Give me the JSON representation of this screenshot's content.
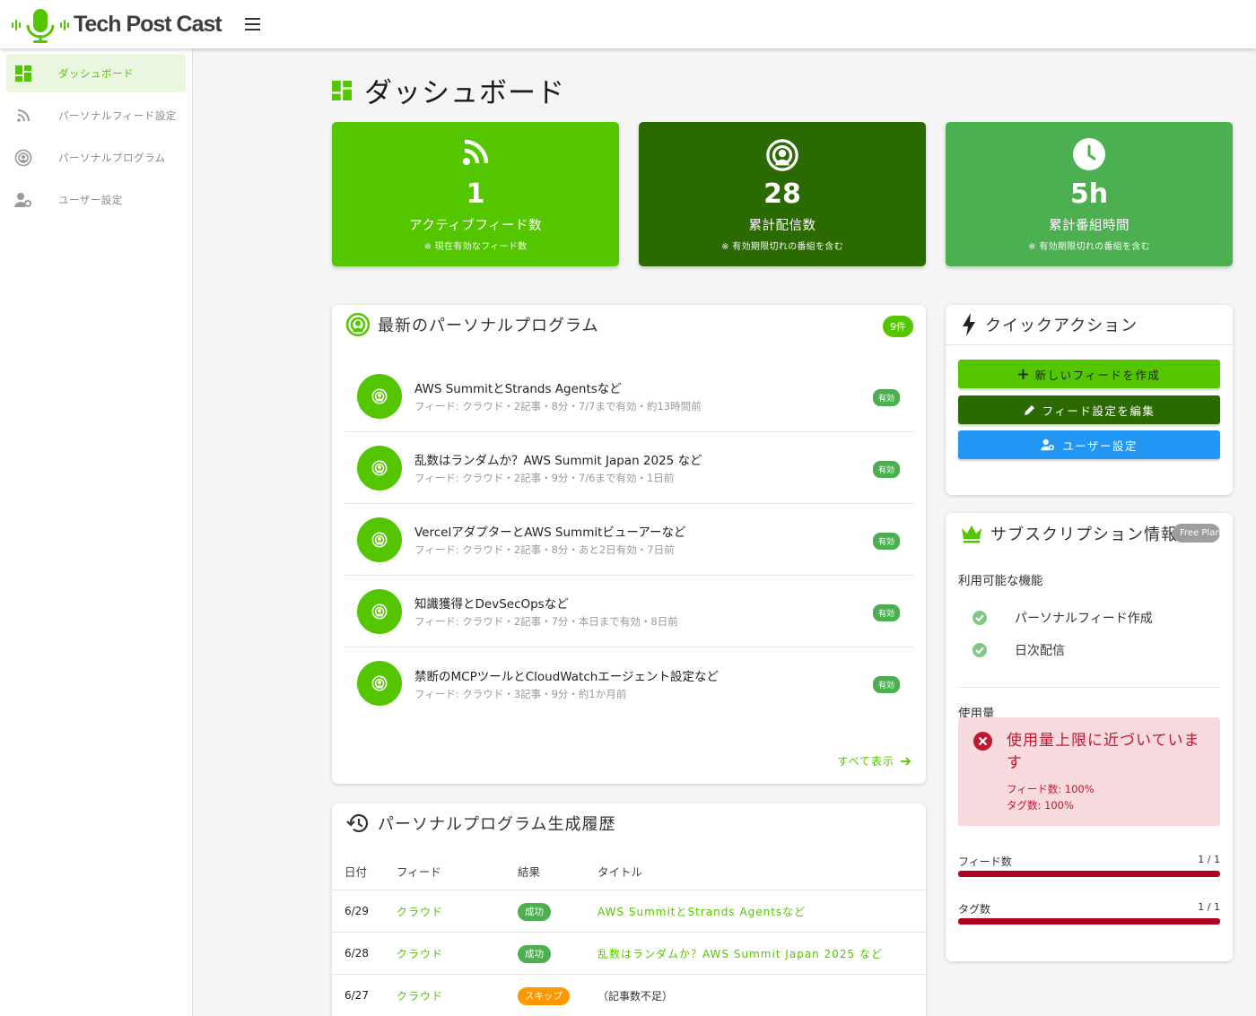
{
  "app": {
    "name": "Tech Post Cast"
  },
  "sidebar": {
    "items": [
      {
        "label": "ダッシュボード",
        "icon": "dashboard-icon",
        "active": true
      },
      {
        "label": "パーソナルフィード設定",
        "icon": "rss-icon",
        "active": false
      },
      {
        "label": "パーソナルプログラム",
        "icon": "podcast-icon",
        "active": false
      },
      {
        "label": "ユーザー設定",
        "icon": "user-settings-icon",
        "active": false
      }
    ]
  },
  "page": {
    "title": "ダッシュボード"
  },
  "stats": [
    {
      "value": "1",
      "label": "アクティブフィード数",
      "note": "※ 現在有効なフィード数",
      "color": "#54c600",
      "icon": "rss-icon"
    },
    {
      "value": "28",
      "label": "累計配信数",
      "note": "※ 有効期限切れの番組を含む",
      "color": "#2b6a00",
      "icon": "podcast-icon"
    },
    {
      "value": "5h",
      "label": "累計番組時間",
      "note": "※ 有効期限切れの番組を含む",
      "color": "#4caf50",
      "icon": "clock-icon"
    }
  ],
  "latest": {
    "title": "最新のパーソナルプログラム",
    "count": "9件",
    "programs": [
      {
        "title": "AWS SummitとStrands Agentsなど",
        "meta": "フィード: クラウド・2記事・8分・7/7まで有効・約13時間前",
        "status": "有効"
      },
      {
        "title": "乱数はランダムか？AWS Summit Japan 2025 など",
        "meta": "フィード: クラウド・2記事・9分・7/6まで有効・1日前",
        "status": "有効"
      },
      {
        "title": "VercelアダプターとAWS Summitビューアーなど",
        "meta": "フィード: クラウド・2記事・8分・あと2日有効・7日前",
        "status": "有効"
      },
      {
        "title": "知識獲得とDevSecOpsなど",
        "meta": "フィード: クラウド・2記事・7分・本日まで有効・8日前",
        "status": "有効"
      },
      {
        "title": "禁断のMCPツールとCloudWatchエージェント設定など",
        "meta": "フィード: クラウド・3記事・9分・約1か月前",
        "status": "有効"
      }
    ],
    "view_all": "すべて表示"
  },
  "history": {
    "title": "パーソナルプログラム生成履歴",
    "headers": [
      "日付",
      "フィード",
      "結果",
      "タイトル"
    ],
    "rows": [
      {
        "date": "6/29",
        "feed": "クラウド",
        "result": "成功",
        "title": "AWS SummitとStrands Agentsなど"
      },
      {
        "date": "6/28",
        "feed": "クラウド",
        "result": "成功",
        "title": "乱数はランダムか？AWS Summit Japan 2025 など"
      },
      {
        "date": "6/27",
        "feed": "クラウド",
        "result": "スキップ",
        "title": "（記事数不足）"
      }
    ]
  },
  "quick_actions": {
    "title": "クイックアクション",
    "buttons": [
      {
        "label": "新しいフィードを作成",
        "icon": "plus-icon",
        "color": "#54c600"
      },
      {
        "label": "フィード設定を編集",
        "icon": "pencil-icon",
        "color": "#2b6a00"
      },
      {
        "label": "ユーザー設定",
        "icon": "user-settings-icon",
        "color": "#2196f3"
      }
    ]
  },
  "subscription": {
    "title": "サブスクリプション情報",
    "plan": "Free Plan",
    "features_label": "利用可能な機能",
    "features": [
      "パーソナルフィード作成",
      "日次配信"
    ],
    "usage_label": "使用量",
    "alert": {
      "title": "使用量上限に近づいています",
      "lines": [
        "フィード数: 100%",
        "タグ数: 100%"
      ]
    },
    "usage": [
      {
        "label": "フィード数",
        "value": "1 / 1",
        "ratio": 1.0
      },
      {
        "label": "タグ数",
        "value": "1 / 1",
        "ratio": 1.0
      }
    ],
    "colors": {
      "bar": "#b0001f",
      "alert_bg": "#f6dadd",
      "alert_text": "#c0182f"
    }
  }
}
